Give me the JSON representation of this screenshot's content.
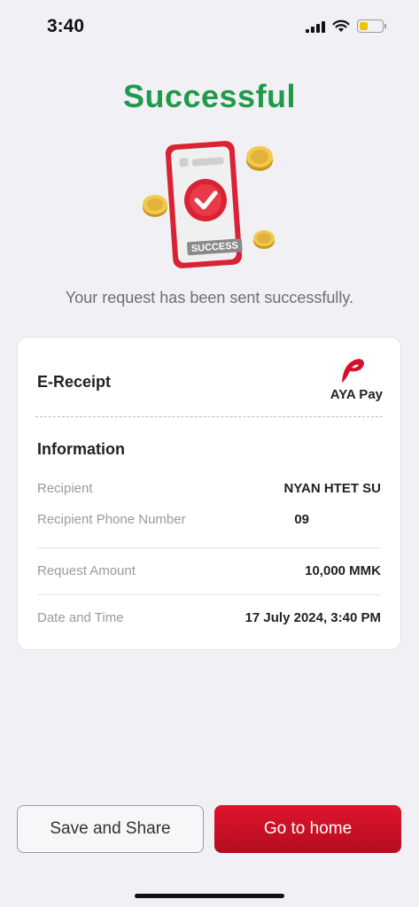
{
  "status_bar": {
    "time": "3:40",
    "battery_color": "#f2c200"
  },
  "header": {
    "title": "Successful",
    "title_color": "#1f9a4a"
  },
  "illustration": {
    "badge_label": "SUCCESS"
  },
  "subtitle": "Your request has been sent successfully.",
  "receipt": {
    "title": "E-Receipt",
    "brand": "AYA Pay",
    "section_title": "Information",
    "rows": [
      {
        "label": "Recipient",
        "value": "NYAN HTET SU"
      },
      {
        "label": "Recipient Phone Number",
        "value": "09"
      },
      {
        "label": "Request Amount",
        "value": "10,000 MMK"
      },
      {
        "label": "Date and Time",
        "value": "17 July 2024, 3:40 PM"
      }
    ]
  },
  "actions": {
    "save_share_label": "Save and Share",
    "home_label": "Go to home",
    "primary_color": "#d4112a"
  }
}
